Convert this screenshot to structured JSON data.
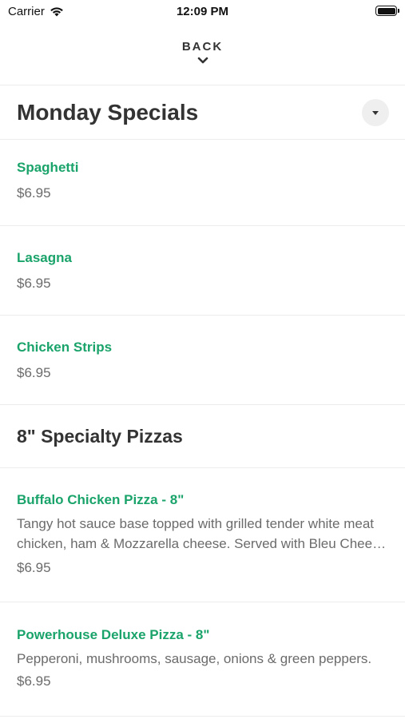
{
  "status_bar": {
    "carrier": "Carrier",
    "time": "12:09 PM",
    "wifi_icon": "wifi-icon",
    "battery_icon": "battery-icon"
  },
  "header": {
    "back_label": "BACK",
    "back_icon": "chevron-down-icon"
  },
  "sections": [
    {
      "title": "Monday Specials",
      "dropdown_icon": "triangle-down-icon",
      "items": [
        {
          "name": "Spaghetti",
          "description": "",
          "price": "$6.95"
        },
        {
          "name": "Lasagna",
          "description": "",
          "price": "$6.95"
        },
        {
          "name": "Chicken Strips",
          "description": "",
          "price": "$6.95"
        }
      ]
    },
    {
      "title": "8\" Specialty Pizzas",
      "items": [
        {
          "name": "Buffalo Chicken Pizza - 8\"",
          "description": "Tangy hot sauce base topped with grilled tender white meat chicken, ham & Mozzarella cheese. Served with Bleu Cheese dressing.",
          "price": "$6.95"
        },
        {
          "name": "Powerhouse Deluxe Pizza - 8\"",
          "description": "Pepperoni, mushrooms, sausage, onions & green peppers.",
          "price": "$6.95"
        }
      ]
    }
  ],
  "colors": {
    "item_name": "#1aa36a",
    "text_muted": "#6b6b6b",
    "heading": "#333333",
    "divider": "#ececec"
  }
}
